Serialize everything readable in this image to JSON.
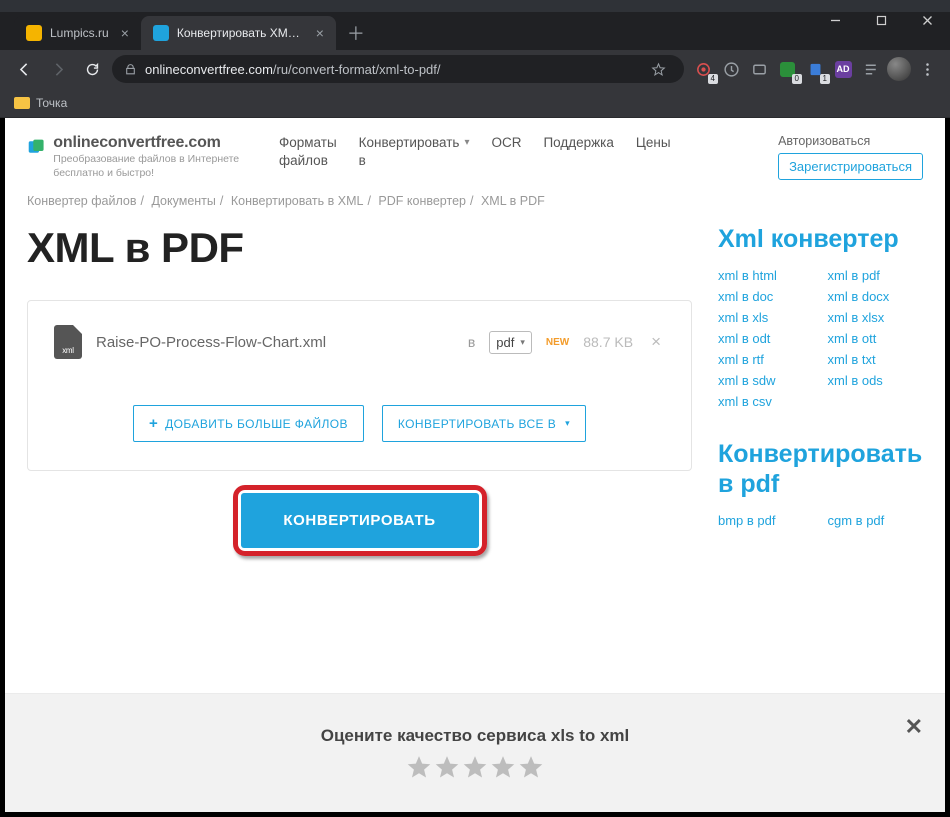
{
  "window": {
    "tabs": [
      {
        "title": "Lumpics.ru",
        "favicon_bg": "#f5b400",
        "favicon_text": ""
      },
      {
        "title": "Конвертировать XML в PDF он…",
        "favicon_bg": "#1fa3dd",
        "favicon_text": ""
      }
    ]
  },
  "toolbar": {
    "url_domain": "onlineconvertfree.com",
    "url_path": "/ru/convert-format/xml-to-pdf/",
    "ext_badges": [
      "4",
      "",
      "",
      "0",
      "1",
      "",
      ""
    ]
  },
  "bookmarks": {
    "item1": "Точка"
  },
  "header": {
    "brand": "onlineconvertfree.com",
    "tagline": "Преобразование файлов в Интернете бесплатно и быстро!",
    "nav_formats_l1": "Форматы",
    "nav_formats_l2": "файлов",
    "nav_convert_l1": "Конвертировать",
    "nav_convert_l2": "в",
    "nav_ocr": "OCR",
    "nav_support": "Поддержка",
    "nav_prices": "Цены",
    "login": "Авторизоваться",
    "register": "Зарегистрироваться"
  },
  "breadcrumb": {
    "a": "Конвертер файлов",
    "b": "Документы",
    "c": "Конвертировать в XML",
    "d": "PDF конвертер",
    "e": "XML в PDF"
  },
  "page": {
    "h1": "XML в PDF"
  },
  "file": {
    "icon_label": "xml",
    "name": "Raise-PO-Process-Flow-Chart.xml",
    "to_label": "в",
    "format": "pdf",
    "new_tag": "NEW",
    "size": "88.7 KB"
  },
  "actions": {
    "add_more": "ДОБАВИТЬ БОЛЬШЕ ФАЙЛОВ",
    "convert_all": "КОНВЕРТИРОВАТЬ ВСЕ В",
    "convert": "КОНВЕРТИРОВАТЬ"
  },
  "sidebar": {
    "h1": "Xml конвертер",
    "links1": [
      "xml в html",
      "xml в pdf",
      "xml в doc",
      "xml в docx",
      "xml в xls",
      "xml в xlsx",
      "xml в odt",
      "xml в ott",
      "xml в rtf",
      "xml в txt",
      "xml в sdw",
      "xml в ods",
      "xml в csv"
    ],
    "h2a": "Конвертировать",
    "h2b": "в pdf",
    "links2": [
      "bmp в pdf",
      "cgm в pdf"
    ]
  },
  "rating": {
    "title": "Оцените качество сервиса xls to xml"
  }
}
